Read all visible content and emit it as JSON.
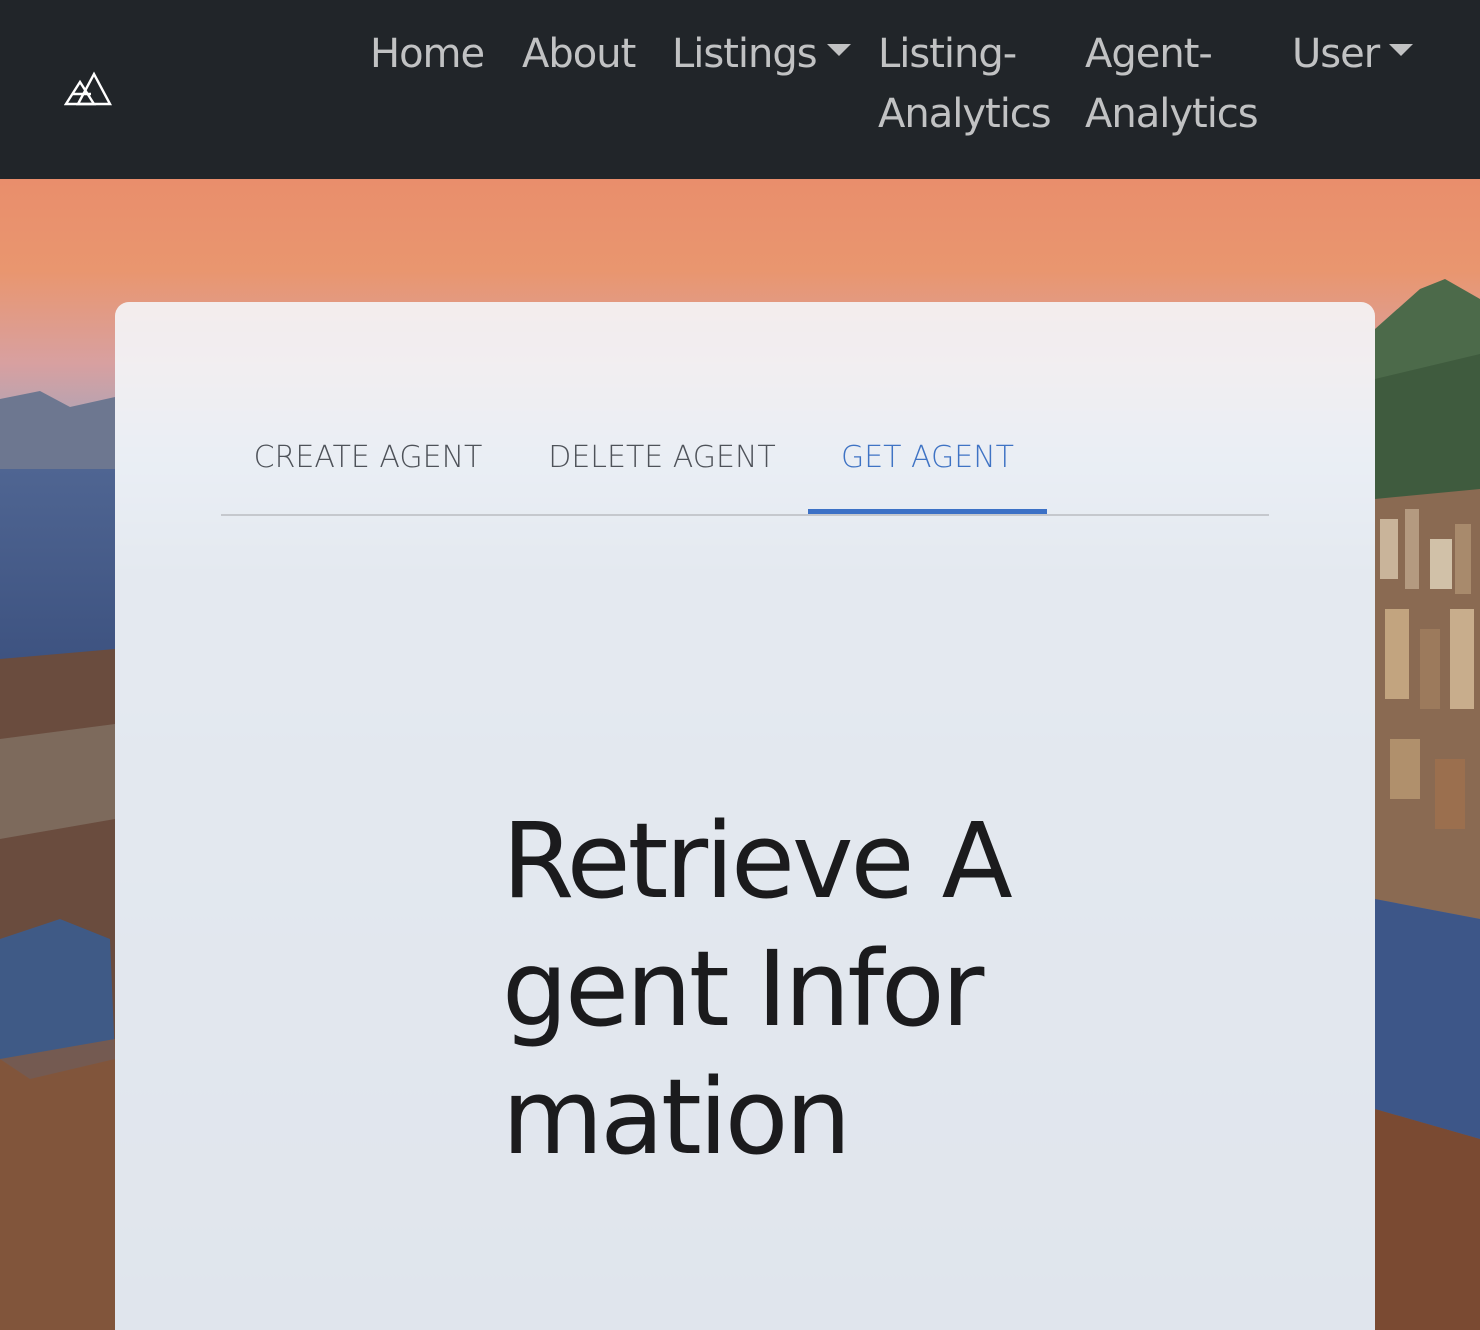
{
  "navbar": {
    "brand_icon": "mountain-logo-icon",
    "links": {
      "home": "Home",
      "about": "About",
      "listings": "Listings",
      "listing_analytics_1": "Listing-",
      "listing_analytics_2": "Analytics",
      "agent_analytics_1": "Agent-",
      "agent_analytics_2": "Analytics",
      "user": "User"
    },
    "colors": {
      "background": "#212529",
      "link": "#bfc1c3"
    }
  },
  "tabs": {
    "create": "CREATE AGENT",
    "delete": "DELETE AGENT",
    "get": "GET AGENT",
    "active": "GET AGENT",
    "accent_color": "#3c71c6"
  },
  "main": {
    "heading": "Retrieve Agent Information"
  }
}
